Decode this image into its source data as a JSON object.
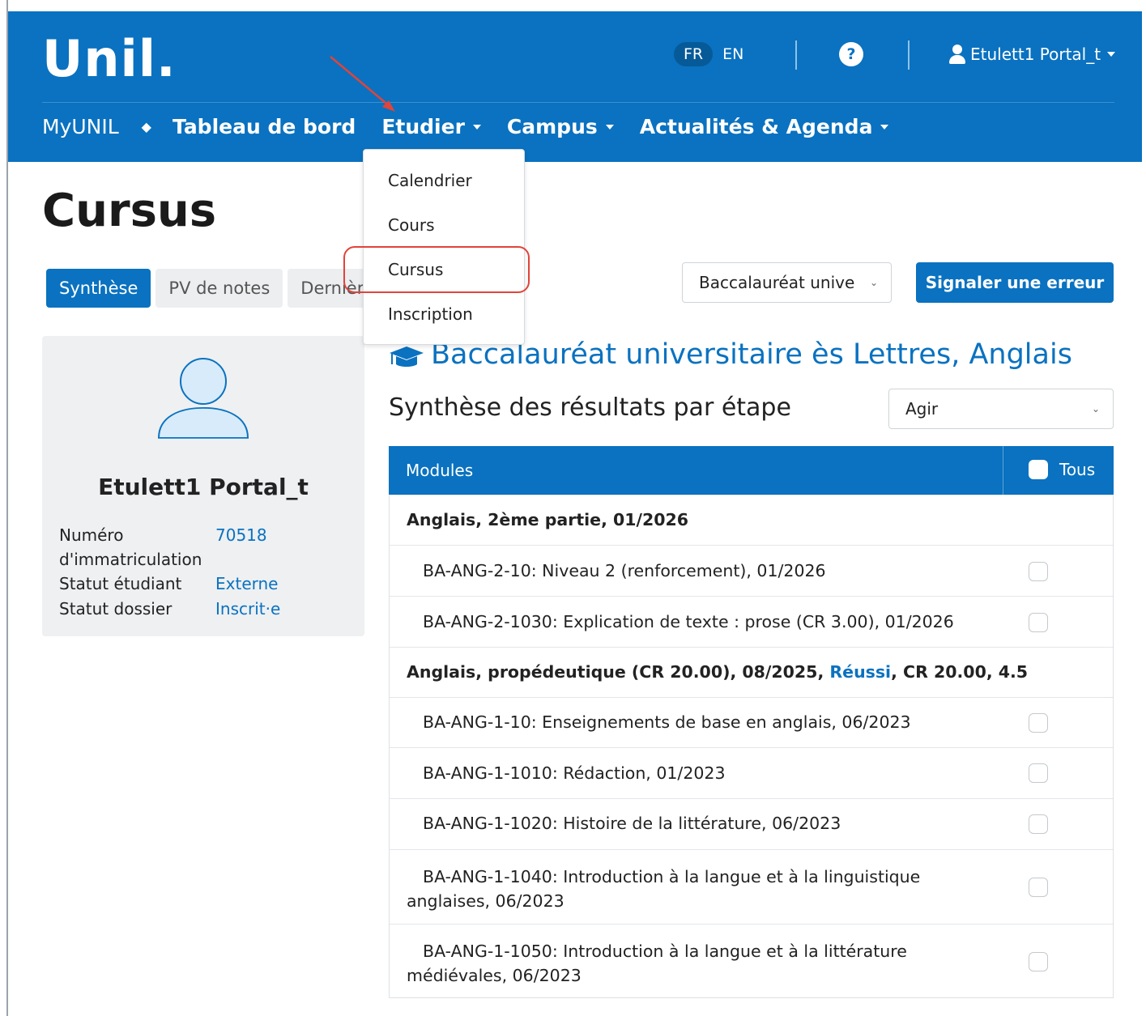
{
  "header": {
    "logo": "Unil.",
    "lang_active": "FR",
    "lang_other": "EN",
    "help": "?",
    "user": "Etulett1 Portal_t"
  },
  "nav": {
    "home": "MyUNIL",
    "separator": "◆",
    "items": [
      "Tableau de bord",
      "Etudier",
      "Campus",
      "Actualités & Agenda"
    ]
  },
  "dropdown": {
    "items": [
      "Calendrier",
      "Cours",
      "Cursus",
      "Inscription"
    ],
    "highlighted": "Cursus"
  },
  "page": {
    "title": "Cursus"
  },
  "tabs": [
    "Synthèse",
    "PV de notes",
    "Dernière"
  ],
  "program_select": "Baccalauréat unive",
  "report_button": "Signaler une erreur",
  "profile": {
    "name": "Etulett1 Portal_t",
    "fields": [
      {
        "label": "Numéro",
        "label2": "d'immatriculation",
        "value": "70518"
      },
      {
        "label": "Statut étudiant",
        "value": "Externe"
      },
      {
        "label": "Statut dossier",
        "value": "Inscrit·e"
      }
    ]
  },
  "program_title": "Baccalauréat universitaire ès Lettres, Anglais",
  "section_title": "Synthèse des résultats par étape",
  "action_select": "Agir",
  "table": {
    "col_modules": "Modules",
    "col_all": "Tous",
    "rows": [
      {
        "type": "group",
        "text": "Anglais, 2ème partie, 01/2026"
      },
      {
        "type": "item",
        "text": "BA-ANG-2-10: Niveau 2 (renforcement), 01/2026"
      },
      {
        "type": "item",
        "text": "BA-ANG-2-1030: Explication de texte : prose (CR 3.00), 01/2026"
      },
      {
        "type": "group",
        "text_before": "Anglais, propédeutique (CR 20.00), 08/2025, ",
        "link": "Réussi",
        "text_after": ", CR 20.00, 4.5"
      },
      {
        "type": "item",
        "text": "BA-ANG-1-10: Enseignements de base en anglais, 06/2023"
      },
      {
        "type": "item",
        "text": "BA-ANG-1-1010: Rédaction, 01/2023"
      },
      {
        "type": "item",
        "text": "BA-ANG-1-1020: Histoire de la littérature, 06/2023"
      },
      {
        "type": "item",
        "text": "BA-ANG-1-1040: Introduction à la langue et à la linguistique anglaises, 06/2023"
      },
      {
        "type": "item",
        "text": "BA-ANG-1-1050: Introduction à la langue et à la littérature médiévales, 06/2023"
      }
    ]
  },
  "icons": {
    "help": "question-circle-icon",
    "user": "user-icon",
    "program": "graduation-cap-icon",
    "avatar": "user-avatar-icon"
  },
  "colors": {
    "brand": "#0a72c0",
    "annotation": "#e0443a"
  }
}
